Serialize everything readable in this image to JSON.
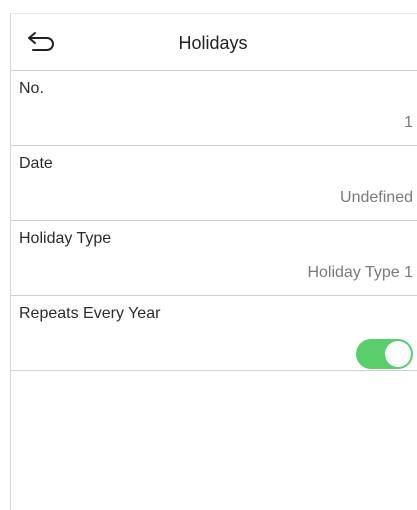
{
  "header": {
    "title": "Holidays",
    "back_icon": "back-arrow-icon"
  },
  "rows": [
    {
      "label": "No.",
      "value": "1"
    },
    {
      "label": "Date",
      "value": "Undefined"
    },
    {
      "label": "Holiday Type",
      "value": "Holiday Type 1"
    },
    {
      "label": "Repeats Every Year",
      "toggle_on": true
    }
  ],
  "colors": {
    "toggle_on": "#58cf6a",
    "divider": "#cfcfcf"
  }
}
